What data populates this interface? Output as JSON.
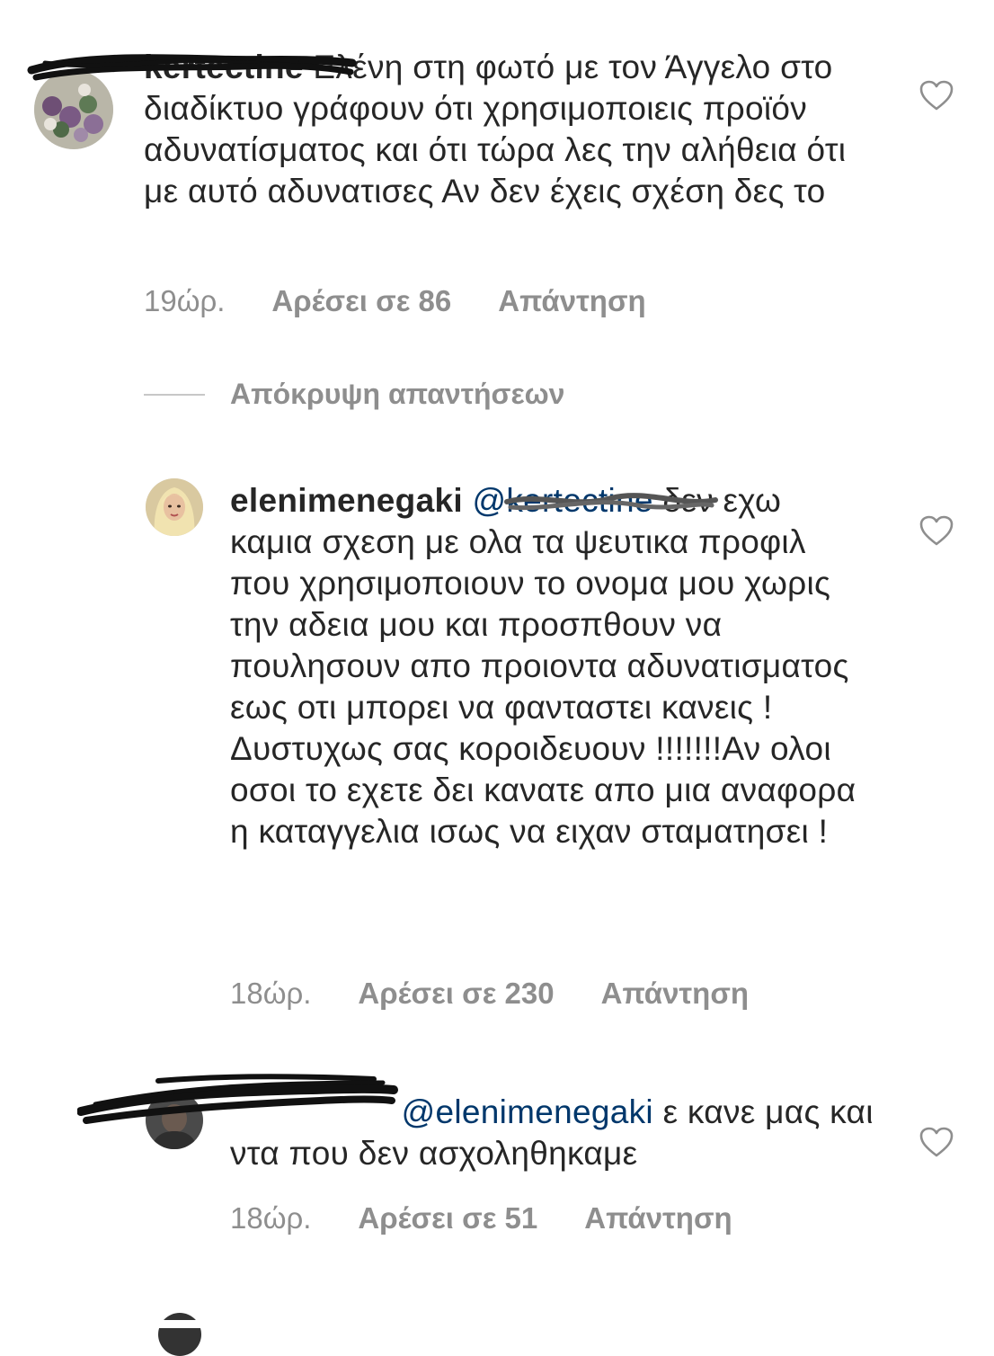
{
  "comments": [
    {
      "username": "kertectine",
      "text": "Ελένη στη φωτό με τον Άγγελο στο διαδίκτυο γράφουν ότι χρησιμοποιεις προϊόν αδυνατίσματος και ότι τώρα λες την αλήθεια ότι με αυτό αδυνατισες Αν δεν έχεις σχέση δες το",
      "time": "19ώρ.",
      "likes": "Αρέσει σε 86",
      "reply": "Απάντηση"
    },
    {
      "username": "elenimenegaki",
      "mention": "@kertectine",
      "text": "δεν εχω καμια σχεση με ολα τα ψευτικα προφιλ που χρησιμοποιουν το ονομα μου χωρις την αδεια μου και προσπθουν να πουλησουν απο προιοντα αδυνατισματος εως οτι μπορει να φανταστει κανεις ! Δυστυχως σας κοροιδευουν !!!!!!!Αν ολοι οσοι το εχετε δει κανατε απο μια αναφορα η καταγγελια ισως να ειχαν σταματησει !",
      "time": "18ώρ.",
      "likes": "Αρέσει σε 230",
      "reply": "Απάντηση"
    },
    {
      "username": "",
      "mention": "@elenimenegaki",
      "text": "ε κανε μας και ντα που δεν ασχοληθηκαμε",
      "time": "18ώρ.",
      "likes": "Αρέσει σε 51",
      "reply": "Απάντηση"
    }
  ],
  "hide_replies": "Απόκρυψη απαντήσεων",
  "icons": {
    "like": "heart-outline-icon"
  },
  "colors": {
    "text": "#262626",
    "meta": "#8e8e8e",
    "mention": "#00376b",
    "divider": "#c7c7c7"
  }
}
